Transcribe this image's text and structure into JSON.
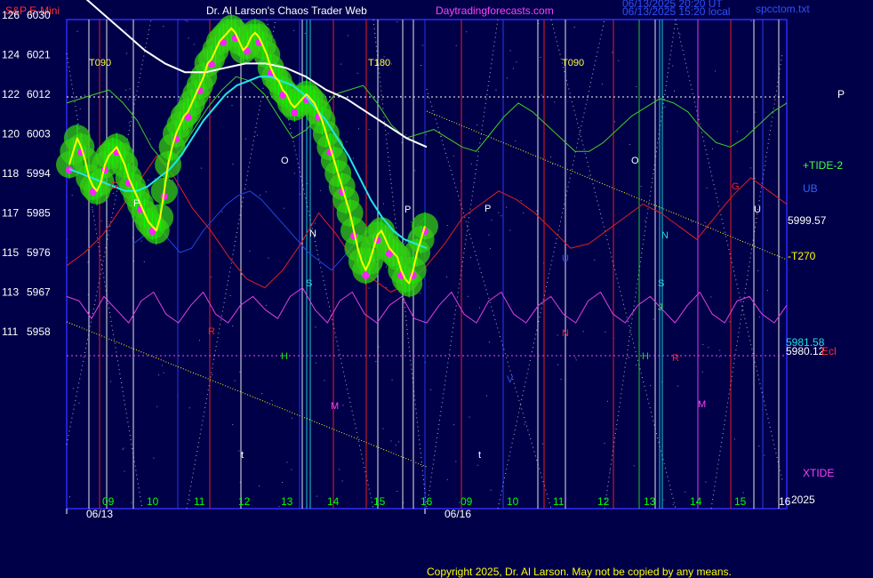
{
  "header": {
    "symbol": "S&P E-Mini",
    "author": "Dr. Al Larson's Chaos Trader Web",
    "site": "Daytradingforecasts.com",
    "stamp1": "06/13/2025 20:20 UT",
    "stamp2": "06/13/2025 15:20 local",
    "file": "spcctom.txt"
  },
  "copyright": "Copyright 2025, Dr. Al Larson. May not be copied by any means.",
  "colors": {
    "background": "#000048",
    "price": "#ffff00",
    "ma_cyan": "#22e6e6",
    "ma_white": "#ffffff",
    "tide": "#44cc22",
    "xtide": "#e040e0",
    "red_line": "#e02020",
    "blue_line": "#2244dd"
  },
  "chart_data": {
    "type": "line",
    "y_ticks": [
      {
        "left": "126",
        "right": "6030"
      },
      {
        "left": "124",
        "right": "6021"
      },
      {
        "left": "122",
        "right": "6012"
      },
      {
        "left": "120",
        "right": "6003"
      },
      {
        "left": "118",
        "right": "5994"
      },
      {
        "left": "117",
        "right": "5985"
      },
      {
        "left": "115",
        "right": "5976"
      },
      {
        "left": "113",
        "right": "5967"
      },
      {
        "left": "111",
        "right": "5958"
      }
    ],
    "ylim": [
      5958,
      6030
    ],
    "hour_ticks": [
      "09",
      "10",
      "11",
      "12",
      "13",
      "14",
      "15",
      "16",
      "09",
      "10",
      "11",
      "12",
      "13",
      "14",
      "15",
      "16"
    ],
    "date_labels": [
      "06/13",
      "06/16"
    ],
    "right_labels": [
      "P",
      "+TIDE-2",
      "UB",
      "5999.57",
      "-T270",
      "5981.58",
      "5980.12",
      "Ecl",
      "XTIDE",
      "2025"
    ],
    "time_labels": [
      "T090",
      "T180",
      "T090"
    ],
    "planet_markers": [
      "G",
      "P",
      "O",
      "N",
      "S",
      "H",
      "R",
      "M",
      "t",
      "P",
      "O",
      "P",
      "N",
      "S",
      "U",
      "H",
      "R",
      "N",
      "M",
      "t",
      "G",
      "V",
      "J",
      "U"
    ],
    "series": [
      {
        "name": "price",
        "values": [
          5996,
          5999,
          6002,
          6000,
          5997,
          5993,
          5991,
          5990,
          5992,
          5996,
          5998,
          5999,
          6000,
          5998,
          5996,
          5993,
          5991,
          5989,
          5987,
          5985,
          5983,
          5982,
          5981,
          5984,
          5990,
          5996,
          6000,
          6003,
          6005,
          6007,
          6008,
          6010,
          6012,
          6014,
          6016,
          6019,
          6020,
          6022,
          6024,
          6025,
          6026,
          6027,
          6026,
          6024,
          6022,
          6023,
          6025,
          6026,
          6025,
          6023,
          6021,
          6018,
          6016,
          6015,
          6013,
          6012,
          6010,
          6009,
          6010,
          6011,
          6012,
          6011,
          6010,
          6008,
          6006,
          6003,
          6000,
          5997,
          5994,
          5991,
          5988,
          5985,
          5981,
          5977,
          5974,
          5972,
          5974,
          5977,
          5980,
          5981,
          5979,
          5977,
          5976,
          5975,
          5972,
          5970,
          5969,
          5972,
          5976,
          5979,
          5982
        ]
      },
      {
        "name": "cyan-ma",
        "values": [
          5995,
          5994,
          5993,
          5992,
          5991,
          5990,
          5990,
          5991,
          5993,
          5995,
          5998,
          6002,
          6006,
          6009,
          6012,
          6014,
          6015,
          6016,
          6016,
          6015,
          6014,
          6012,
          6009,
          6006,
          6002,
          5998,
          5993,
          5988,
          5984,
          5981,
          5979,
          5978,
          5977
        ]
      },
      {
        "name": "white-ma",
        "values": [
          6034,
          6030,
          6026,
          6022,
          6019,
          6017,
          6017,
          6018,
          6019,
          6019,
          6018,
          6016,
          6013,
          6011,
          6008,
          6005,
          6002,
          6000
        ]
      },
      {
        "name": "TIDE-2",
        "values": [
          6010,
          6011,
          6012,
          6013,
          6010,
          6006,
          6000,
          5996,
          5999,
          6004,
          6009,
          6013,
          6016,
          6015,
          6012,
          6007,
          6002,
          6004,
          6008,
          6012,
          6013,
          6014,
          6010,
          6005,
          6002,
          6003,
          6004,
          6002,
          6000,
          5999,
          6003,
          6007,
          6010,
          6008,
          6005,
          6002,
          5999,
          5999,
          6001,
          6004,
          6007,
          6009,
          6011,
          6010,
          6008,
          6004,
          6001,
          6000,
          6002,
          6005,
          6008,
          6010
        ]
      },
      {
        "name": "XTIDE",
        "values": [
          5966,
          5965,
          5961,
          5966,
          5963,
          5960,
          5965,
          5967,
          5962,
          5960,
          5964,
          5967,
          5962,
          5960,
          5964,
          5966,
          5963,
          5961,
          5966,
          5968,
          5963,
          5960,
          5965,
          5967,
          5962,
          5960,
          5964,
          5966,
          5961,
          5960,
          5964,
          5967,
          5962,
          5960,
          5965,
          5967,
          5962,
          5960,
          5964,
          5966,
          5962,
          5960,
          5965,
          5967,
          5962,
          5960,
          5964,
          5966,
          5963,
          5960,
          5964,
          5967,
          5962,
          5960,
          5965,
          5966,
          5962,
          5960,
          5964
        ]
      },
      {
        "name": "red",
        "values": [
          5973,
          5976,
          5980,
          5986,
          5992,
          5998,
          5993,
          5986,
          5981,
          5975,
          5970,
          5968,
          5972,
          5978,
          5985,
          5980,
          5974,
          5970,
          5967,
          5969,
          5973,
          5978,
          5984,
          5987,
          5990,
          5988,
          5985,
          5981,
          5977,
          5978,
          5981,
          5984,
          5987,
          5985,
          5982,
          5979,
          5984,
          5989,
          5993,
          5990,
          5987
        ]
      },
      {
        "name": "blue",
        "values": [
          5978,
          5980,
          5983,
          5979,
          5976,
          5977,
          5981,
          5984,
          5987,
          5989,
          5990,
          5988,
          5985,
          5982,
          5979,
          5976,
          5974,
          5972,
          5975,
          5978,
          5981,
          5978,
          5975,
          5977,
          5981,
          5984
        ]
      }
    ]
  }
}
